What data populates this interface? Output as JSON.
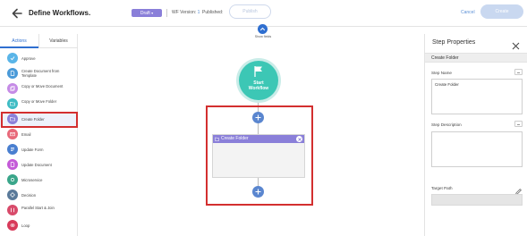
{
  "header": {
    "title": "Define Workflows.",
    "status_badge": "Draft",
    "wf_version_label": "WF Version:",
    "wf_version_value": "1",
    "published_label": "Published:",
    "publish_button": "Publish",
    "cancel_link": "Cancel",
    "create_button": "Create"
  },
  "sidebar": {
    "tabs": [
      {
        "label": "Actions",
        "active": true
      },
      {
        "label": "Variables",
        "active": false
      }
    ],
    "items": [
      {
        "label": "Approve",
        "color": "#5ab5e8",
        "icon": "check-icon"
      },
      {
        "label": "Create Document from Template",
        "color": "#4a9ad8",
        "icon": "document-icon"
      },
      {
        "label": "Copy or Move Document",
        "color": "#c58be6",
        "icon": "copy-icon"
      },
      {
        "label": "Copy or Move Folder",
        "color": "#3fbcc4",
        "icon": "folder-icon"
      },
      {
        "label": "Create Folder",
        "color": "#8a7fd9",
        "icon": "folder-plus-icon",
        "selected": true
      },
      {
        "label": "Email",
        "color": "#e8697a",
        "icon": "email-icon"
      },
      {
        "label": "Update Form",
        "color": "#4a7fd0",
        "icon": "form-icon"
      },
      {
        "label": "Update Document",
        "color": "#c45ad8",
        "icon": "document-edit-icon"
      },
      {
        "label": "Microservice",
        "color": "#3aa68a",
        "icon": "microservice-icon"
      },
      {
        "label": "Decision",
        "color": "#5a7a9a",
        "icon": "decision-icon"
      },
      {
        "label": "Parallel Start & Join",
        "color": "#d84a6a",
        "icon": "parallel-icon"
      },
      {
        "label": "Loop",
        "color": "#d83a5a",
        "icon": "loop-icon"
      }
    ]
  },
  "canvas": {
    "show_fields_label": "Show fields",
    "start_label_1": "Start",
    "start_label_2": "Workflow",
    "node_title": "Create Folder"
  },
  "panel": {
    "title": "Step Properties",
    "subheader": "Create Folder",
    "step_name_label": "Step Name",
    "step_name_value": "Create Folder",
    "step_description_label": "Step Description",
    "step_description_value": "",
    "target_path_label": "Target Path",
    "target_path_value": ""
  },
  "colors": {
    "accent": "#2f6fd0",
    "draft_badge": "#8a7fd9",
    "start_node": "#3cc7b5",
    "highlight": "#d32f2f"
  }
}
